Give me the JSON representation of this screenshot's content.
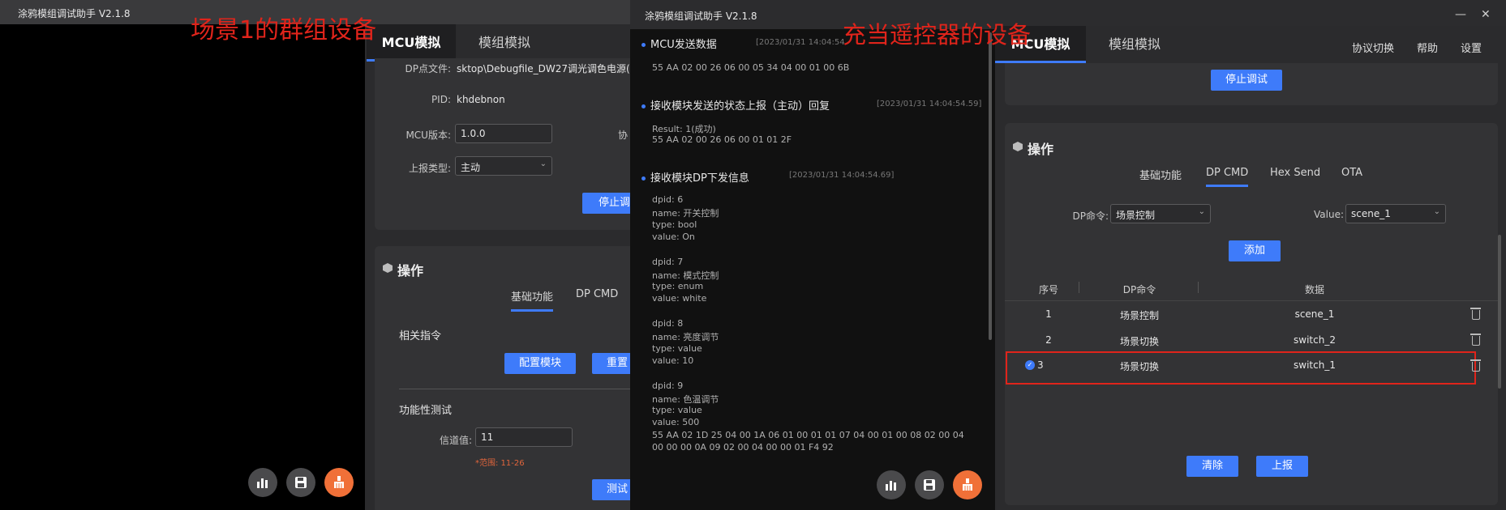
{
  "window1": {
    "title": "涂鸦模组调试助手 V2.1.8",
    "annotation": "场景1的群组设备",
    "tabs": [
      "MCU模拟",
      "模组模拟"
    ],
    "info": {
      "dp_file_label": "DP点文件:",
      "dp_file_value": "sktop\\Debugfile_DW27调光调色电源(",
      "pid_label": "PID:",
      "pid_value": "khdebnon",
      "mcu_version_label": "MCU版本:",
      "mcu_version_value": "1.0.0",
      "protocol_label_partial": "协",
      "report_type_label": "上报类型:",
      "report_type_value": "主动",
      "stop_debug_partial": "停止调"
    },
    "operation": {
      "title": "操作",
      "subtabs": [
        "基础功能",
        "DP CMD"
      ],
      "related_commands": "相关指令",
      "config_module": "配置模块",
      "reset_partial": "重置",
      "function_test": "功能性测试",
      "channel_label": "信道值:",
      "channel_value": "11",
      "range_hint": "*范围: 11-26",
      "test_partial": "测试"
    }
  },
  "window2": {
    "title": "涂鸦模组调试助手 V2.1.8",
    "annotation": "充当遥控器的设备",
    "log": [
      {
        "head": "MCU发送数据",
        "time": "[2023/01/31 14:04:54",
        "lines": [
          "55 AA 02 00 26 06 00 05 34 04 00 01 00 6B"
        ]
      },
      {
        "head": "接收模块发送的状态上报（主动）回复",
        "time": "[2023/01/31 14:04:54.59]",
        "lines": [
          "Result: 1(成功)",
          "55 AA 02 00 26 06 00 01 01 2F"
        ]
      },
      {
        "head": "接收模块DP下发信息",
        "time": "[2023/01/31 14:04:54.69]",
        "lines": [
          "dpid: 6",
          "name: 开关控制",
          "type: bool",
          "value: On",
          "",
          "dpid: 7",
          "name: 模式控制",
          "type: enum",
          "value: white",
          "",
          "dpid: 8",
          "name: 亮度调节",
          "type: value",
          "value: 10",
          "",
          "dpid: 9",
          "name: 色温调节",
          "type: value",
          "value: 500",
          "55 AA 02 1D 25 04 00 1A 06 01 00 01 01 07 04 00 01 00 08 02 00 04",
          "00 00 00 0A 09 02 00 04 00 00 01 F4 92"
        ]
      }
    ]
  },
  "window3": {
    "tabs": [
      "MCU模拟",
      "模组模拟"
    ],
    "top_links": [
      "协议切换",
      "帮助",
      "设置"
    ],
    "stop_debug": "停止调试",
    "operation": {
      "title": "操作",
      "subtabs": [
        "基础功能",
        "DP CMD",
        "Hex Send",
        "OTA"
      ],
      "dp_cmd_label": "DP命令:",
      "dp_cmd_value": "场景控制",
      "value_label": "Value:",
      "value_value": "scene_1",
      "add": "添加",
      "table_headers": [
        "序号",
        "DP命令",
        "数据"
      ],
      "rows": [
        {
          "no": "1",
          "cmd": "场景控制",
          "data": "scene_1"
        },
        {
          "no": "2",
          "cmd": "场景切换",
          "data": "switch_2"
        },
        {
          "no": "3",
          "cmd": "场景切换",
          "data": "switch_1"
        }
      ],
      "clear": "清除",
      "report": "上报"
    }
  },
  "colors": {
    "accent": "#3e7bfa",
    "annotation": "#e0241b",
    "orange": "#f07038"
  }
}
